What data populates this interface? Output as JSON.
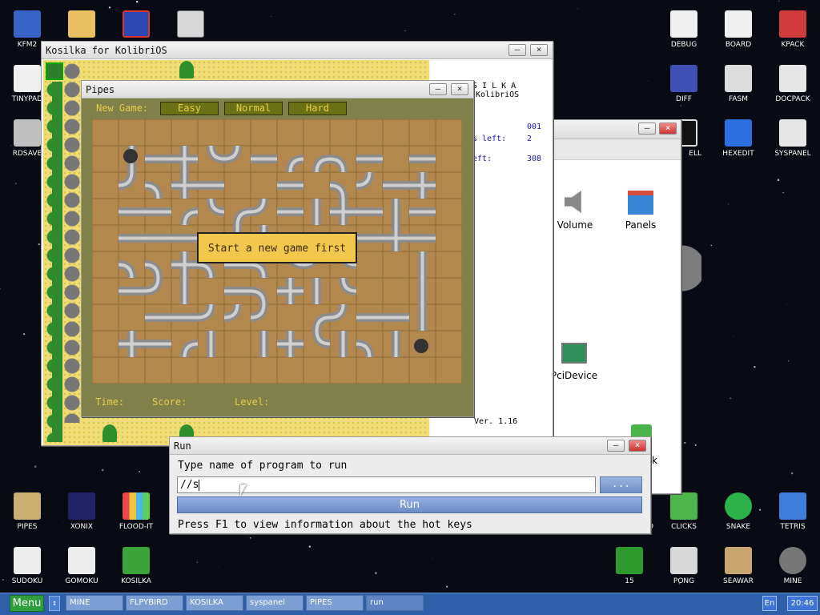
{
  "desktop_icons": [
    {
      "id": "kfm2",
      "label": "KFM2",
      "icon": "floppy-icon",
      "color": "#3a63c9"
    },
    {
      "id": "folder",
      "label": "",
      "icon": "folder-icon",
      "color": "#e8c061"
    },
    {
      "id": "app-blue",
      "label": "",
      "icon": "app-window-icon",
      "color": "#2c49b3"
    },
    {
      "id": "calc",
      "label": "",
      "icon": "calculator-icon",
      "color": "#d7d7d7"
    },
    {
      "id": "tinypad",
      "label": "TINYPAD",
      "icon": "notepad-icon",
      "color": "#f0f0f0"
    },
    {
      "id": "rdsave",
      "label": "RDSAVE",
      "icon": "disk-save-icon",
      "color": "#bfbfbf"
    },
    {
      "id": "debug",
      "label": "DEBUG",
      "icon": "bug-icon",
      "color": "#efefef"
    },
    {
      "id": "board",
      "label": "BOARD",
      "icon": "board-icon",
      "color": "#efefef"
    },
    {
      "id": "kpack",
      "label": "KPACK",
      "icon": "hammer-icon",
      "color": "#d23b3b"
    },
    {
      "id": "diff",
      "label": "DIFF",
      "icon": "diff-icon",
      "color": "#3f4fb6"
    },
    {
      "id": "fasm",
      "label": "FASM",
      "icon": "fasm-icon",
      "color": "#dcdcdc"
    },
    {
      "id": "docpack",
      "label": "DOCPACK",
      "icon": "cabinet-icon",
      "color": "#e6e6e6"
    },
    {
      "id": "shell",
      "label": "ELL",
      "icon": "shell-icon",
      "color": "#111111"
    },
    {
      "id": "hexedit",
      "label": "HEXEDIT",
      "icon": "hex-icon",
      "color": "#2a6ee0"
    },
    {
      "id": "syspanel",
      "label": "SYSPANEL",
      "icon": "sliders-icon",
      "color": "#e6e6e6"
    },
    {
      "id": "pipes",
      "label": "PIPES",
      "icon": "pipes-icon",
      "color": "#c8b070"
    },
    {
      "id": "xonix",
      "label": "XONIX",
      "icon": "xonix-icon",
      "color": "#222266"
    },
    {
      "id": "floodit",
      "label": "FLOOD-IT",
      "icon": "flood-icon",
      "color": "#e84a4a"
    },
    {
      "id": "sudoku",
      "label": "SUDOKU",
      "icon": "sudoku-icon",
      "color": "#ededed"
    },
    {
      "id": "gomoku",
      "label": "GOMOKU",
      "icon": "gomoku-icon",
      "color": "#ededed"
    },
    {
      "id": "kosilka",
      "label": "KOSILKA",
      "icon": "mower-icon",
      "color": "#3aa33a"
    },
    {
      "id": "cut-d",
      "label": "D",
      "icon": "",
      "color": ""
    },
    {
      "id": "clicks",
      "label": "CLICKS",
      "icon": "blocks-icon",
      "color": "#4bb54b"
    },
    {
      "id": "snake",
      "label": "SNAKE",
      "icon": "snake-icon",
      "color": "#2bb24a"
    },
    {
      "id": "tetris",
      "label": "TETRIS",
      "icon": "tetris-icon",
      "color": "#3b7dd8"
    },
    {
      "id": "fifteen",
      "label": "15",
      "icon": "grid-icon",
      "color": "#2e9a2e"
    },
    {
      "id": "pong",
      "label": "PONG",
      "icon": "pong-icon",
      "color": "#d8d8d8"
    },
    {
      "id": "seawar",
      "label": "SEAWAR",
      "icon": "ship-icon",
      "color": "#c9a670"
    },
    {
      "id": "mine",
      "label": "MINE",
      "icon": "mine-icon",
      "color": "#777777"
    }
  ],
  "kosilka": {
    "title": "Kosilka for KolibriOS",
    "info_header": "S I L K A",
    "info_sub": "KolibriOS",
    "line1_value": "001",
    "line2_label": "s left:",
    "line2_value": "2",
    "line3_label": "eft:",
    "line3_value": "308",
    "version": "Ver. 1.16"
  },
  "syspanel": {
    "volume_label": "Volume",
    "panels_label": "Panels",
    "pcidevice_label": "PciDevice",
    "cut_label": "k"
  },
  "pipes": {
    "title": "Pipes",
    "new_game_label": "New Game:",
    "easy_label": "Easy",
    "normal_label": "Normal",
    "hard_label": "Hard",
    "message": "Start a new game first",
    "time_label": "Time:",
    "score_label": "Score:",
    "level_label": "Level:"
  },
  "run": {
    "title": "Run",
    "prompt": "Type name of program to run",
    "input_value": "//s",
    "browse_label": "...",
    "run_label": "Run",
    "hint": "Press F1 to view information about the hot keys"
  },
  "taskbar": {
    "menu_label": "Menu",
    "tasks": [
      {
        "label": "MINE",
        "active": false
      },
      {
        "label": "FLPYBIRD",
        "active": false
      },
      {
        "label": "KOSILKA",
        "active": false
      },
      {
        "label": "syspanel",
        "active": false
      },
      {
        "label": "PIPES",
        "active": false
      },
      {
        "label": "run",
        "active": true
      }
    ],
    "lang": "En",
    "clock": "20:46"
  },
  "colors": {
    "desktop": "#080b14",
    "taskbar": "#2f5fa8",
    "pipes_bg": "#80804a",
    "pipes_text": "#e6cd4a",
    "board": "#b2884e",
    "pipe": "#9a9a9a"
  }
}
